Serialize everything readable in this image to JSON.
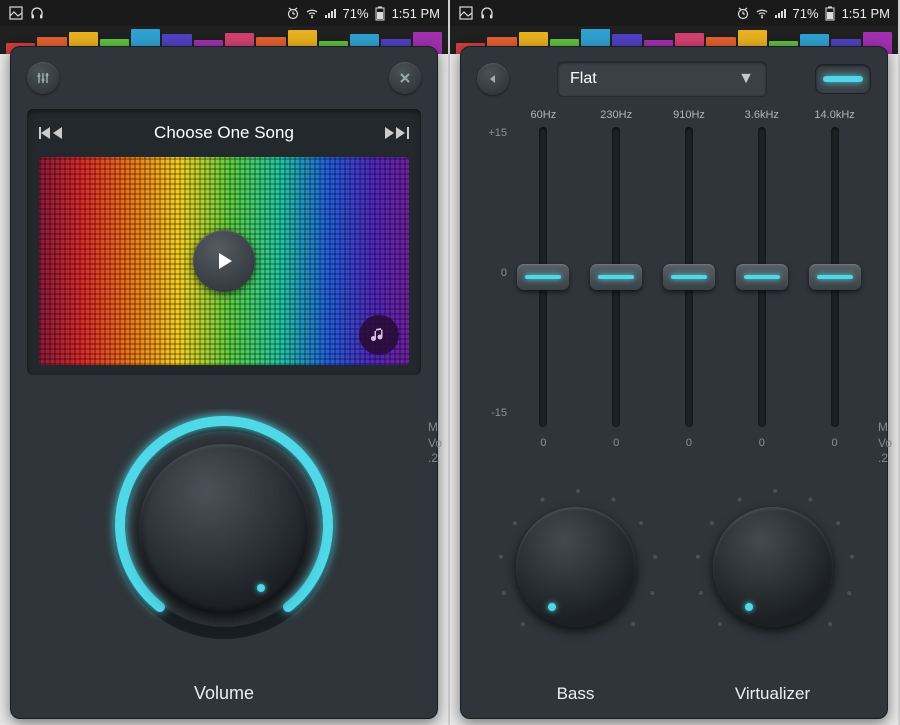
{
  "status": {
    "battery": "71%",
    "time": "1:51 PM"
  },
  "left": {
    "track_title": "Choose One Song",
    "volume_label": "Volume"
  },
  "right": {
    "preset": "Flat",
    "yaxis_top": "+15",
    "yaxis_mid": "0",
    "yaxis_bot": "-15",
    "bands": [
      {
        "freq": "60Hz",
        "val": "0",
        "pos": 50
      },
      {
        "freq": "230Hz",
        "val": "0",
        "pos": 50
      },
      {
        "freq": "910Hz",
        "val": "0",
        "pos": 50
      },
      {
        "freq": "3.6kHz",
        "val": "0",
        "pos": 50
      },
      {
        "freq": "14.0kHz",
        "val": "0",
        "pos": 50
      }
    ],
    "bass_label": "Bass",
    "virt_label": "Virtualizer"
  }
}
